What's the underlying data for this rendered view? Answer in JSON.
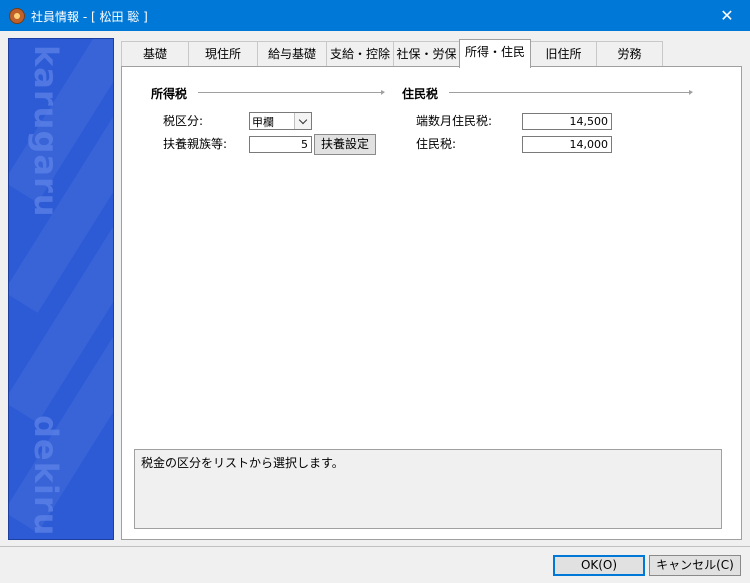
{
  "window": {
    "title": "社員情報 - [ 松田 聡 ]",
    "close_glyph": "✕"
  },
  "sidebar": {
    "words": [
      "karugaru",
      "dekiru"
    ]
  },
  "tabs": [
    {
      "label": "基礎",
      "active": false
    },
    {
      "label": "現住所",
      "active": false
    },
    {
      "label": "給与基礎",
      "active": false
    },
    {
      "label": "支給・控除",
      "active": false
    },
    {
      "label": "社保・労保",
      "active": false
    },
    {
      "label": "所得・住民",
      "active": true
    },
    {
      "label": "旧住所",
      "active": false
    },
    {
      "label": "労務",
      "active": false
    }
  ],
  "income_tax": {
    "title": "所得税",
    "tax_class_label": "税区分:",
    "tax_class_value": "甲欄",
    "dependents_label": "扶養親族等:",
    "dependents_value": "5",
    "dependents_button": "扶養設定"
  },
  "resident_tax": {
    "title": "住民税",
    "fraction_month_label": "端数月住民税:",
    "fraction_month_value": "14,500",
    "resident_tax_label": "住民税:",
    "resident_tax_value": "14,000"
  },
  "message": {
    "text": "税金の区分をリストから選択します。"
  },
  "footer": {
    "ok_label": "OK(O)",
    "cancel_label": "キャンセル(C)"
  },
  "colors": {
    "titlebar": "#0078d7",
    "sidepanel": "#2d5bd6"
  },
  "icons": {
    "app": "app-logo-icon",
    "close": "close-icon",
    "dropdown": "chevron-down-icon"
  }
}
